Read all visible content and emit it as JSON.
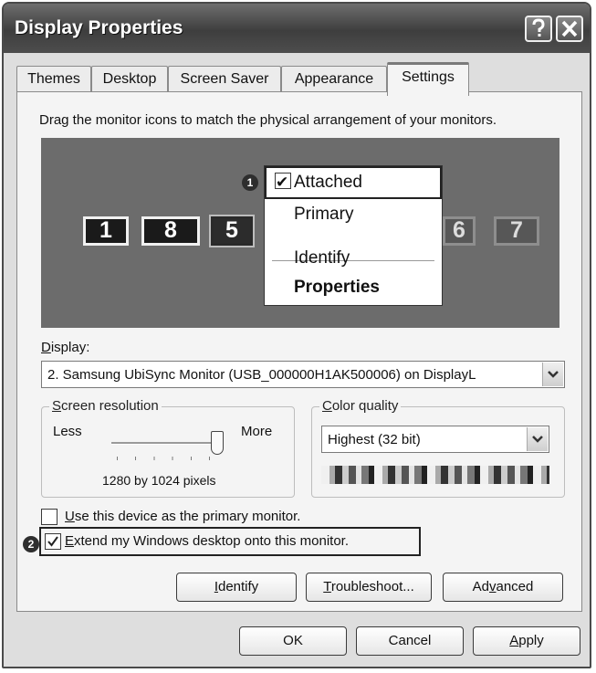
{
  "window": {
    "title": "Display Properties"
  },
  "tabs": [
    {
      "label": "Themes"
    },
    {
      "label": "Desktop"
    },
    {
      "label": "Screen Saver"
    },
    {
      "label": "Appearance"
    },
    {
      "label": "Settings"
    }
  ],
  "settings": {
    "instruction": "Drag the monitor icons to match the physical arrangement of your monitors.",
    "monitors": [
      {
        "label": "1"
      },
      {
        "label": "8"
      },
      {
        "label": "5"
      },
      {
        "label": "6"
      },
      {
        "label": "7"
      }
    ],
    "callouts": [
      "1",
      "2"
    ],
    "context_menu": {
      "check_mark": "✔",
      "items": [
        {
          "label": "Attached"
        },
        {
          "label": "Primary"
        },
        {
          "label": "Identify"
        },
        {
          "label": "Properties"
        }
      ]
    },
    "display_label_underlined": "D",
    "display_label_rest": "isplay:",
    "display_value": "2. Samsung UbiSync Monitor (USB_000000H1AK500006) on DisplayL",
    "screen_resolution": {
      "label_underlined": "S",
      "label_rest": "creen resolution",
      "less": "Less",
      "more": "More",
      "value": "1280 by 1024 pixels",
      "slider_level": 1.0
    },
    "color_quality": {
      "label_underlined": "C",
      "label_rest": "olor quality",
      "value": "Highest (32 bit)"
    },
    "checkboxes": [
      {
        "label_underlined": "U",
        "label_rest": "se this device as the primary monitor.",
        "checked": false
      },
      {
        "label_underlined": "E",
        "label_rest": "xtend my Windows desktop onto this monitor.",
        "checked": true
      }
    ],
    "buttons": [
      {
        "underlined": "I",
        "rest": "dentify"
      },
      {
        "underlined": "T",
        "rest": "roubleshoot..."
      },
      {
        "pre": "Ad",
        "underlined": "v",
        "rest": "anced"
      }
    ]
  },
  "footer": {
    "ok": "OK",
    "cancel": "Cancel",
    "apply_underlined": "A",
    "apply_rest": "pply"
  }
}
